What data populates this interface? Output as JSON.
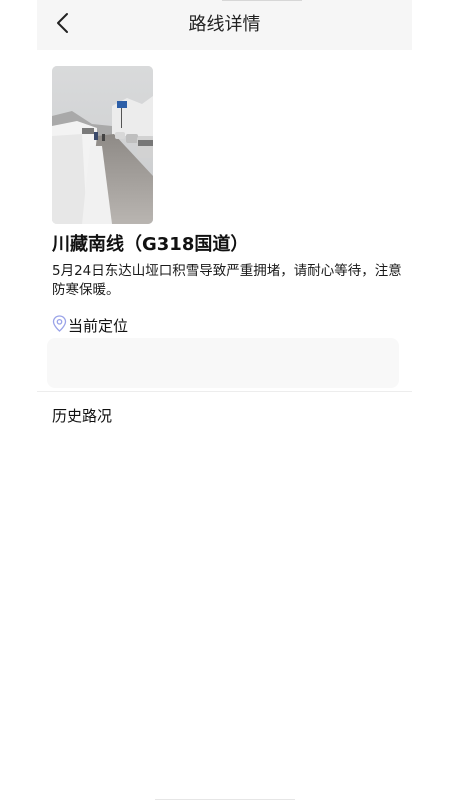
{
  "header": {
    "title": "路线详情",
    "back_icon": "chevron-left-icon"
  },
  "route": {
    "photo_description_icon": "snow-road-photo",
    "title": "川藏南线（G318国道）",
    "description": "5月24日东达山垭口积雪导致严重拥堵，请耐心等待，注意防寒保暖。"
  },
  "location": {
    "icon": "location-pin-icon",
    "label": "当前定位",
    "value": ""
  },
  "history": {
    "label": "历史路况"
  },
  "colors": {
    "header_bg": "#f6f6f6",
    "pin_icon": "#9aa3e8",
    "location_box_bg": "#f8f8f8"
  }
}
